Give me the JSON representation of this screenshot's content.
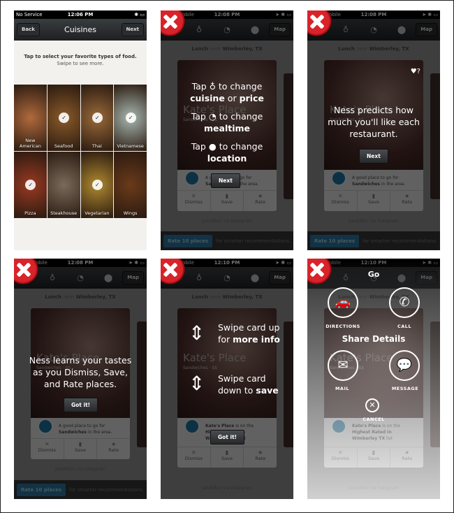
{
  "reject_badge_icon": "red-x-icon",
  "colors": {
    "reject": "#d8232a",
    "accent": "#2b6f99"
  },
  "screen1": {
    "status": {
      "carrier": "No Service",
      "time": "12:06 PM"
    },
    "nav": {
      "back": "Back",
      "title": "Cuisines",
      "next": "Next"
    },
    "instruction": "Tap to select your favorite types of food.",
    "hint": "Swipe to see more.",
    "tiles": [
      {
        "label": "New American",
        "selected": false
      },
      {
        "label": "Seafood",
        "selected": true
      },
      {
        "label": "Thai",
        "selected": true
      },
      {
        "label": "Vietnamese",
        "selected": true
      },
      {
        "label": "Pizza",
        "selected": true
      },
      {
        "label": "Steakhouse",
        "selected": false
      },
      {
        "label": "Vegetarian",
        "selected": true
      },
      {
        "label": "Wings",
        "selected": false
      }
    ]
  },
  "common": {
    "carrier": "obile",
    "map": "Map",
    "meal": "Lunch",
    "near": "near",
    "location": "Wimberley, TX",
    "card_title": "Kate's Place",
    "card_category": "Sandwiches · $$",
    "blurb_a": "A good place to go for",
    "blurb_b": "Sandwiches",
    "blurb_c": "in the area.",
    "blurb2_a": "Kate's Place",
    "blurb2_b": "is on the",
    "blurb2_c": "Highest Rated In",
    "blurb2_d": "Wimberley TX",
    "blurb2_e": "list",
    "dismiss": "Dismiss",
    "save": "Save",
    "rate": "Rate",
    "credit": "paultilton via Instagram",
    "rate_button": "Rate 10 places",
    "rate_suffix": "for smarter recommendations."
  },
  "screen2": {
    "time": "12:08 PM",
    "line1": "Tap",
    "line1b": "to change",
    "line2a": "cuisine",
    "line2b": "or",
    "line2c": "price",
    "line3": "Tap",
    "line3b": "to change",
    "line4": "mealtime",
    "line5": "Tap",
    "line5b": "to change",
    "line6": "location",
    "button": "Next"
  },
  "screen3": {
    "time": "12:08 PM",
    "text": "Ness predicts how much you'll like each restaurant.",
    "button": "Next"
  },
  "screen4": {
    "time": "12:08 PM",
    "text": "Ness learns your tastes as you Dismiss, Save, and Rate places.",
    "button": "Got it!"
  },
  "screen5": {
    "time": "12:10 PM",
    "up_a": "Swipe card up for",
    "up_b": "more info",
    "down_a": "Swipe card down to",
    "down_b": "save",
    "button": "Got it!"
  },
  "screen6": {
    "time": "12:10 PM",
    "title": "Go",
    "directions": "DIRECTIONS",
    "call": "CALL",
    "share": "Share Details",
    "mail": "MAIL",
    "message": "MESSAGE",
    "cancel": "CANCEL"
  }
}
